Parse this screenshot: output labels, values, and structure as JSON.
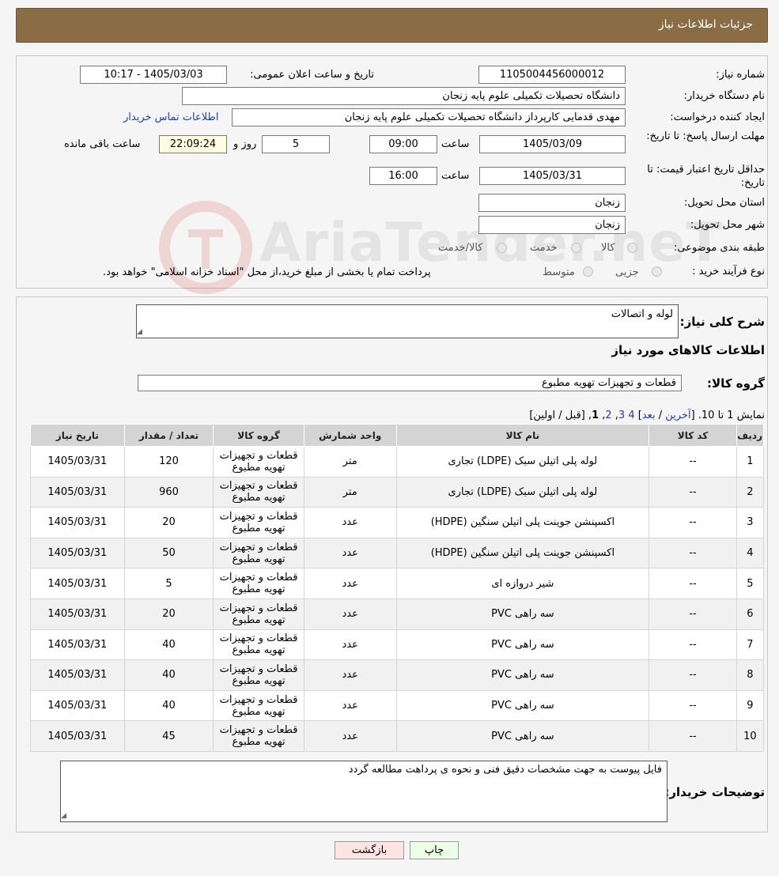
{
  "header": {
    "title": "جزئیات اطلاعات نیاز"
  },
  "form": {
    "need_number_label": "شماره نیاز:",
    "need_number": "1105004456000012",
    "announce_label": "تاریخ و ساعت اعلان عمومی:",
    "announce_value": "1405/03/03 - 10:17",
    "buyer_label": "نام دستگاه خریدار:",
    "buyer_value": "دانشگاه تحصیلات تکمیلی علوم پایه زنجان",
    "creator_label": "ایجاد کننده درخواست:",
    "creator_value": "مهدی قدمایی کارپرداز دانشگاه تحصیلات تکمیلی علوم پایه زنجان",
    "contact_link": "اطلاعات تماس خریدار",
    "deadline_label": "مهلت ارسال پاسخ: تا تاریخ:",
    "deadline_date": "1405/03/09",
    "time_label": "ساعت",
    "deadline_time": "09:00",
    "days_value": "5",
    "days_label": "روز و",
    "remaining_time": "22:09:24",
    "remaining_label": "ساعت باقی مانده",
    "validity_label": "حداقل تاریخ اعتبار قیمت: تا تاریخ:",
    "validity_date": "1405/03/31",
    "validity_time": "16:00",
    "province_label": "استان محل تحویل:",
    "province_value": "زنجان",
    "city_label": "شهر محل تحویل:",
    "city_value": "زنجان",
    "category_label": "طبقه بندی موضوعی:",
    "category_options": [
      "کالا",
      "خدمت",
      "کالا/خدمت"
    ],
    "process_label": "نوع فرآیند خرید :",
    "process_options": [
      "جزیی",
      "متوسط"
    ],
    "process_note": "پرداخت تمام یا بخشی از مبلغ خرید،از محل \"اسناد خزانه اسلامی\" خواهد بود."
  },
  "details": {
    "summary_label": "شرح کلی نیاز:",
    "summary_value": "لوله و اتصالات",
    "goods_info_title": "اطلاعات کالاهای مورد نیاز",
    "group_label": "گروه کالا:",
    "group_value": "قطعات و تجهیزات تهویه مطبوع",
    "pager_prefix": "نمایش 1 تا 10. [",
    "pager_last": "آخرین",
    "pager_sep": " / ",
    "pager_next": "بعد",
    "pager_close": "]",
    "pager_pages": [
      "4",
      "3",
      "2"
    ],
    "pager_current": "1",
    "pager_suffix": "[قبل / اولین]"
  },
  "table": {
    "headers": [
      "ردیف",
      "کد کالا",
      "نام کالا",
      "واحد شمارش",
      "گروه کالا",
      "تعداد / مقدار",
      "تاریخ نیاز"
    ],
    "rows": [
      [
        "1",
        "--",
        "لوله پلی اتیلن سبک (LDPE) تجاری",
        "متر",
        "قطعات و تجهیزات تهویه مطبوع",
        "120",
        "1405/03/31"
      ],
      [
        "2",
        "--",
        "لوله پلی اتیلن سبک (LDPE) تجاری",
        "متر",
        "قطعات و تجهیزات تهویه مطبوع",
        "960",
        "1405/03/31"
      ],
      [
        "3",
        "--",
        "اکسپنشن جوینت پلی اتیلن سنگین (HDPE)",
        "عدد",
        "قطعات و تجهیزات تهویه مطبوع",
        "20",
        "1405/03/31"
      ],
      [
        "4",
        "--",
        "اکسپنشن جوینت پلی اتیلن سنگین (HDPE)",
        "عدد",
        "قطعات و تجهیزات تهویه مطبوع",
        "50",
        "1405/03/31"
      ],
      [
        "5",
        "--",
        "شیر دروازه ای",
        "عدد",
        "قطعات و تجهیزات تهویه مطبوع",
        "5",
        "1405/03/31"
      ],
      [
        "6",
        "--",
        "سه راهی PVC",
        "عدد",
        "قطعات و تجهیزات تهویه مطبوع",
        "20",
        "1405/03/31"
      ],
      [
        "7",
        "--",
        "سه راهی PVC",
        "عدد",
        "قطعات و تجهیزات تهویه مطبوع",
        "40",
        "1405/03/31"
      ],
      [
        "8",
        "--",
        "سه راهی PVC",
        "عدد",
        "قطعات و تجهیزات تهویه مطبوع",
        "40",
        "1405/03/31"
      ],
      [
        "9",
        "--",
        "سه راهی PVC",
        "عدد",
        "قطعات و تجهیزات تهویه مطبوع",
        "40",
        "1405/03/31"
      ],
      [
        "10",
        "--",
        "سه راهی PVC",
        "عدد",
        "قطعات و تجهیزات تهویه مطبوع",
        "45",
        "1405/03/31"
      ]
    ]
  },
  "buyer_notes": {
    "label": "توضیحات خریدار:",
    "value": "فایل پیوست به جهت مشخصات دقیق فنی و نحوه ی پرداهت مطالعه گردد"
  },
  "buttons": {
    "print": "چاپ",
    "back": "بازگشت"
  },
  "watermark": {
    "text": "AriaTender.neT"
  }
}
